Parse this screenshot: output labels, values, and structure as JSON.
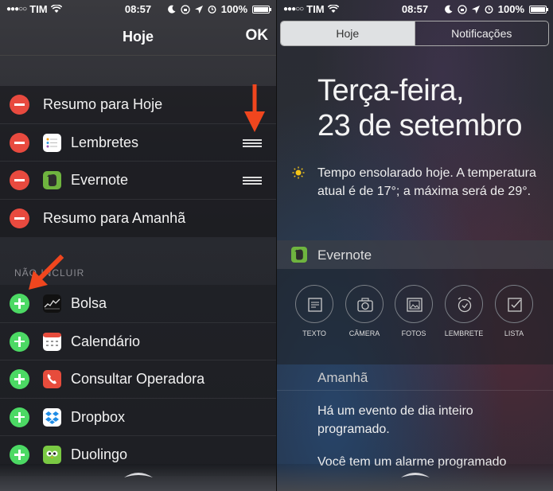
{
  "status_bar": {
    "carrier": "TIM",
    "time": "08:57",
    "battery": "100%"
  },
  "left": {
    "title": "Hoje",
    "ok_label": "OK",
    "included": [
      {
        "label": "Resumo para Hoje",
        "icon": null
      },
      {
        "label": "Lembretes",
        "icon": "reminders-icon"
      },
      {
        "label": "Evernote",
        "icon": "evernote-icon"
      },
      {
        "label": "Resumo para Amanhã",
        "icon": null
      }
    ],
    "section_header": "NÃO INCLUIR",
    "excluded": [
      {
        "label": "Bolsa",
        "icon": "stocks-icon"
      },
      {
        "label": "Calendário",
        "icon": "calendar-icon"
      },
      {
        "label": "Consultar Operadora",
        "icon": "phone-icon"
      },
      {
        "label": "Dropbox",
        "icon": "dropbox-icon"
      },
      {
        "label": "Duolingo",
        "icon": "duolingo-icon"
      }
    ]
  },
  "right": {
    "tabs": [
      {
        "label": "Hoje",
        "active": true
      },
      {
        "label": "Notificações",
        "active": false
      }
    ],
    "day_line1": "Terça-feira,",
    "day_line2": "23 de setembro",
    "weather": "Tempo ensolarado hoje. A temperatura atual é de 17°; a máxima será de 29°.",
    "evernote": {
      "title": "Evernote",
      "actions": [
        {
          "label": "TEXTO",
          "icon": "note-icon"
        },
        {
          "label": "CÂMERA",
          "icon": "camera-icon"
        },
        {
          "label": "FOTOS",
          "icon": "photo-icon"
        },
        {
          "label": "LEMBRETE",
          "icon": "alarm-icon"
        },
        {
          "label": "LISTA",
          "icon": "checklist-icon"
        }
      ]
    },
    "tomorrow": {
      "title": "Amanhã",
      "event": "Há um evento de dia inteiro programado.",
      "alarm": "Você tem um alarme programado"
    }
  },
  "colors": {
    "remove": "#e84a3f",
    "add": "#4cd964",
    "arrow": "#f0461e"
  }
}
